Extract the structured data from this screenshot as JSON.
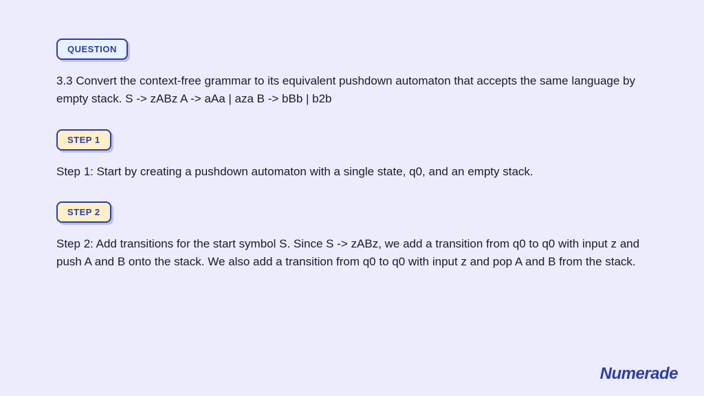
{
  "question": {
    "badge": "QUESTION",
    "text": "3.3 Convert the context-free grammar to its equivalent pushdown automaton that accepts the same language by empty stack. S -> zABz A -> aAa | aza B -> bBb | b2b"
  },
  "steps": [
    {
      "badge": "STEP 1",
      "text": "Step 1: Start by creating a pushdown automaton with a single state, q0, and an empty stack."
    },
    {
      "badge": "STEP 2",
      "text": "Step 2: Add transitions for the start symbol S. Since S -> zABz, we add a transition from q0 to q0 with input z and push A and B onto the stack. We also add a transition from q0 to q0 with input z and pop A and B from the stack."
    }
  ],
  "brand": "Numerade"
}
